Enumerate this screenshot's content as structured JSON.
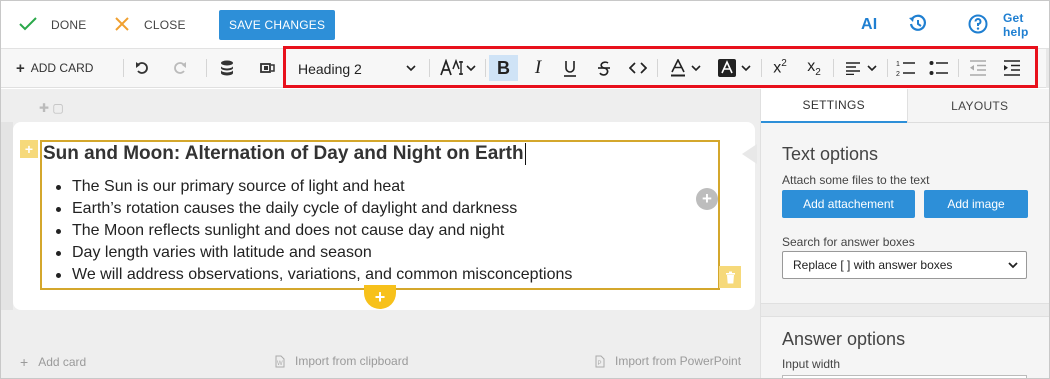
{
  "topbar": {
    "done_label": "DONE",
    "close_label": "CLOSE",
    "save_label": "SAVE CHANGES",
    "ai_label": "AI",
    "help_label": "Get help",
    "colors": {
      "accent": "#2d8fd8",
      "done": "#2aa84a",
      "close": "#f0a030"
    }
  },
  "toolbar": {
    "add_card_label": "ADD CARD",
    "style_value": "Heading 2",
    "highlight_color": "#e8101c",
    "icons": [
      "undo-icon",
      "redo-icon",
      "database-icon",
      "presentation-icon",
      "font-size-icon",
      "bold-icon",
      "italic-icon",
      "underline-icon",
      "strikethrough-icon",
      "code-icon",
      "text-color-icon",
      "background-color-icon",
      "superscript-icon",
      "subscript-icon",
      "align-icon",
      "numbered-list-icon",
      "bulleted-list-icon",
      "outdent-icon",
      "indent-icon"
    ]
  },
  "editor": {
    "heading": "Sun and Moon: Alternation of Day and Night on Earth",
    "bullets": [
      "The Sun is our primary source of light and heat",
      "Earth’s rotation causes the daily cycle of daylight and darkness",
      "The Moon reflects sunlight and does not cause day and night",
      "Day length varies with latitude and season",
      "We will address observations, variations, and common misconceptions"
    ],
    "add_card_label": "Add card",
    "import_clipboard_label": "Import from clipboard",
    "import_ppt_label": "Import from PowerPoint"
  },
  "panel": {
    "tabs": [
      "SETTINGS",
      "LAYOUTS"
    ],
    "text_options_title": "Text options",
    "attach_text": "Attach some files to the text",
    "add_attachment_label": "Add attachement",
    "add_image_label": "Add image",
    "search_label": "Search for answer boxes",
    "search_select_value": "Replace [ ] with answer boxes",
    "answer_options_title": "Answer options",
    "input_width_label": "Input width"
  }
}
